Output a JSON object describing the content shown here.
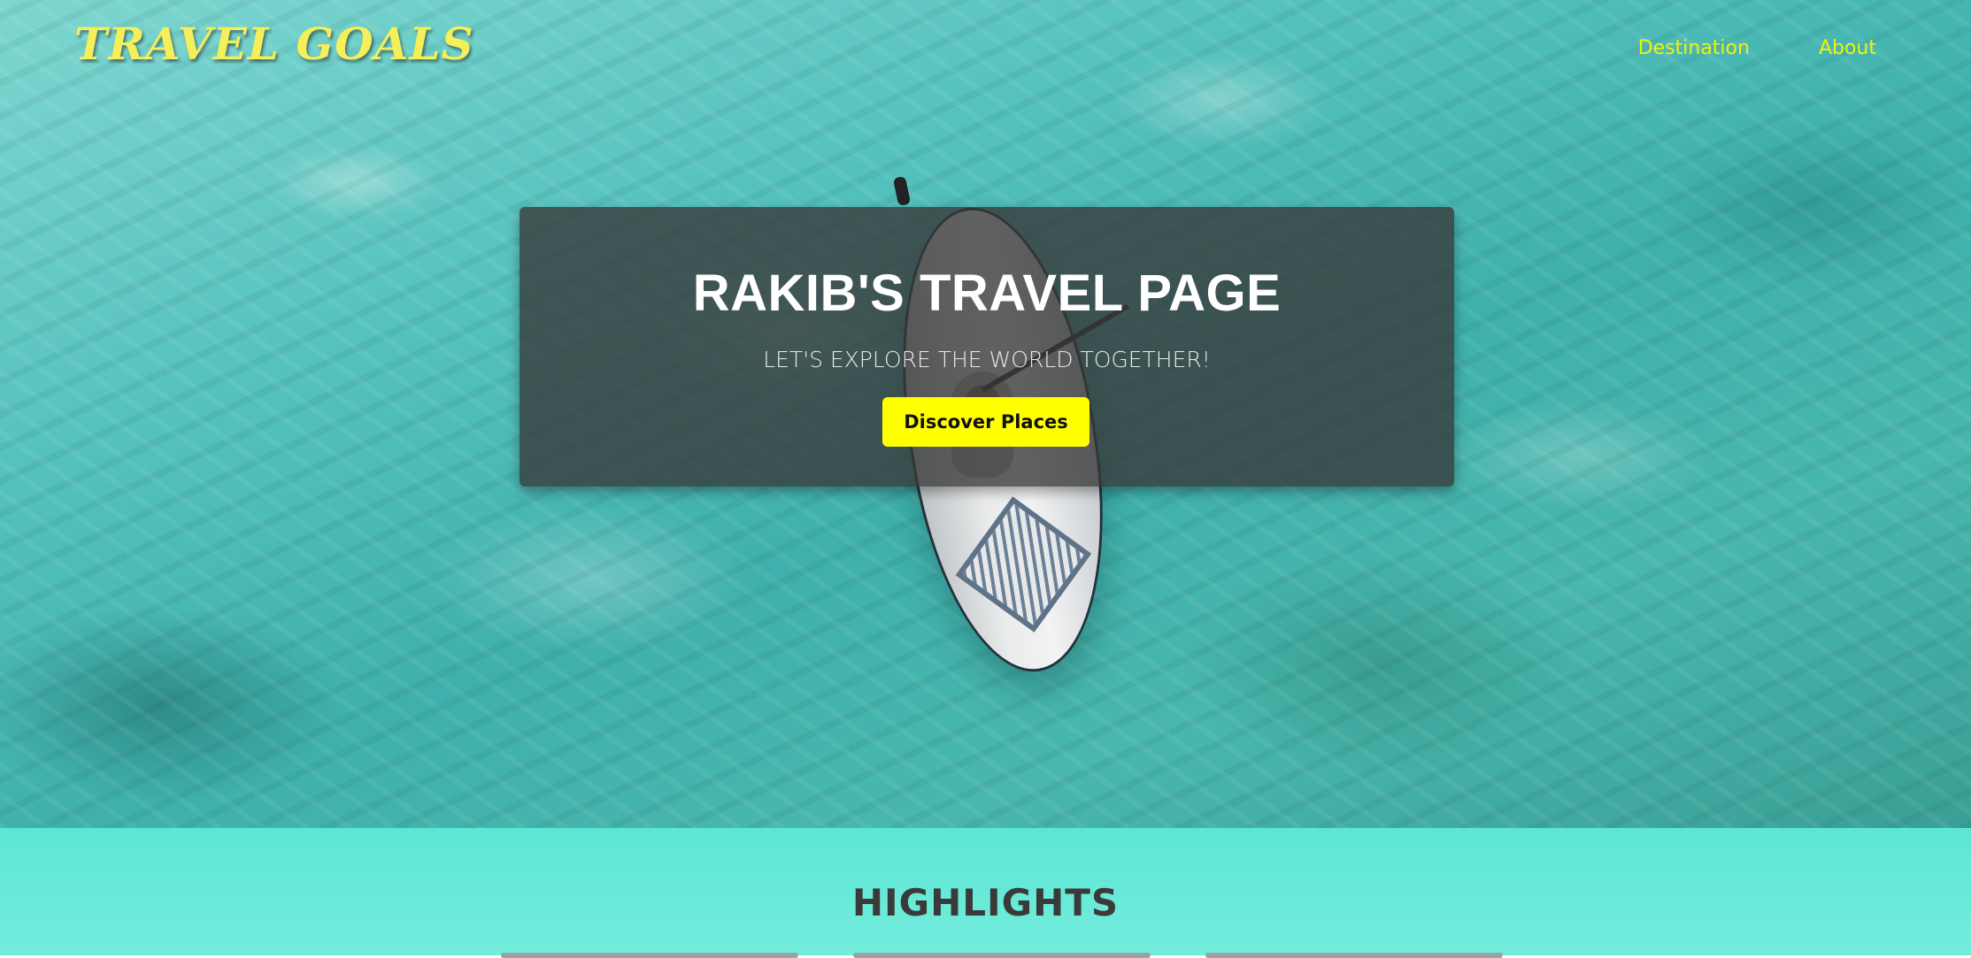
{
  "nav": {
    "brand": "TRAVEL GOALS",
    "links": [
      {
        "label": "Destination"
      },
      {
        "label": "About"
      }
    ]
  },
  "hero": {
    "title": "RAKIB'S TRAVEL PAGE",
    "subtitle": "LET'S EXPLORE THE WORLD TOGETHER!",
    "cta_label": "Discover Places"
  },
  "highlights": {
    "heading": "HIGHLIGHTS"
  },
  "colors": {
    "brand_yellow": "#f4ef5a",
    "nav_link_yellow": "#f2f20d",
    "cta_yellow": "#ffff00",
    "highlights_bg": "#5be6d4"
  }
}
